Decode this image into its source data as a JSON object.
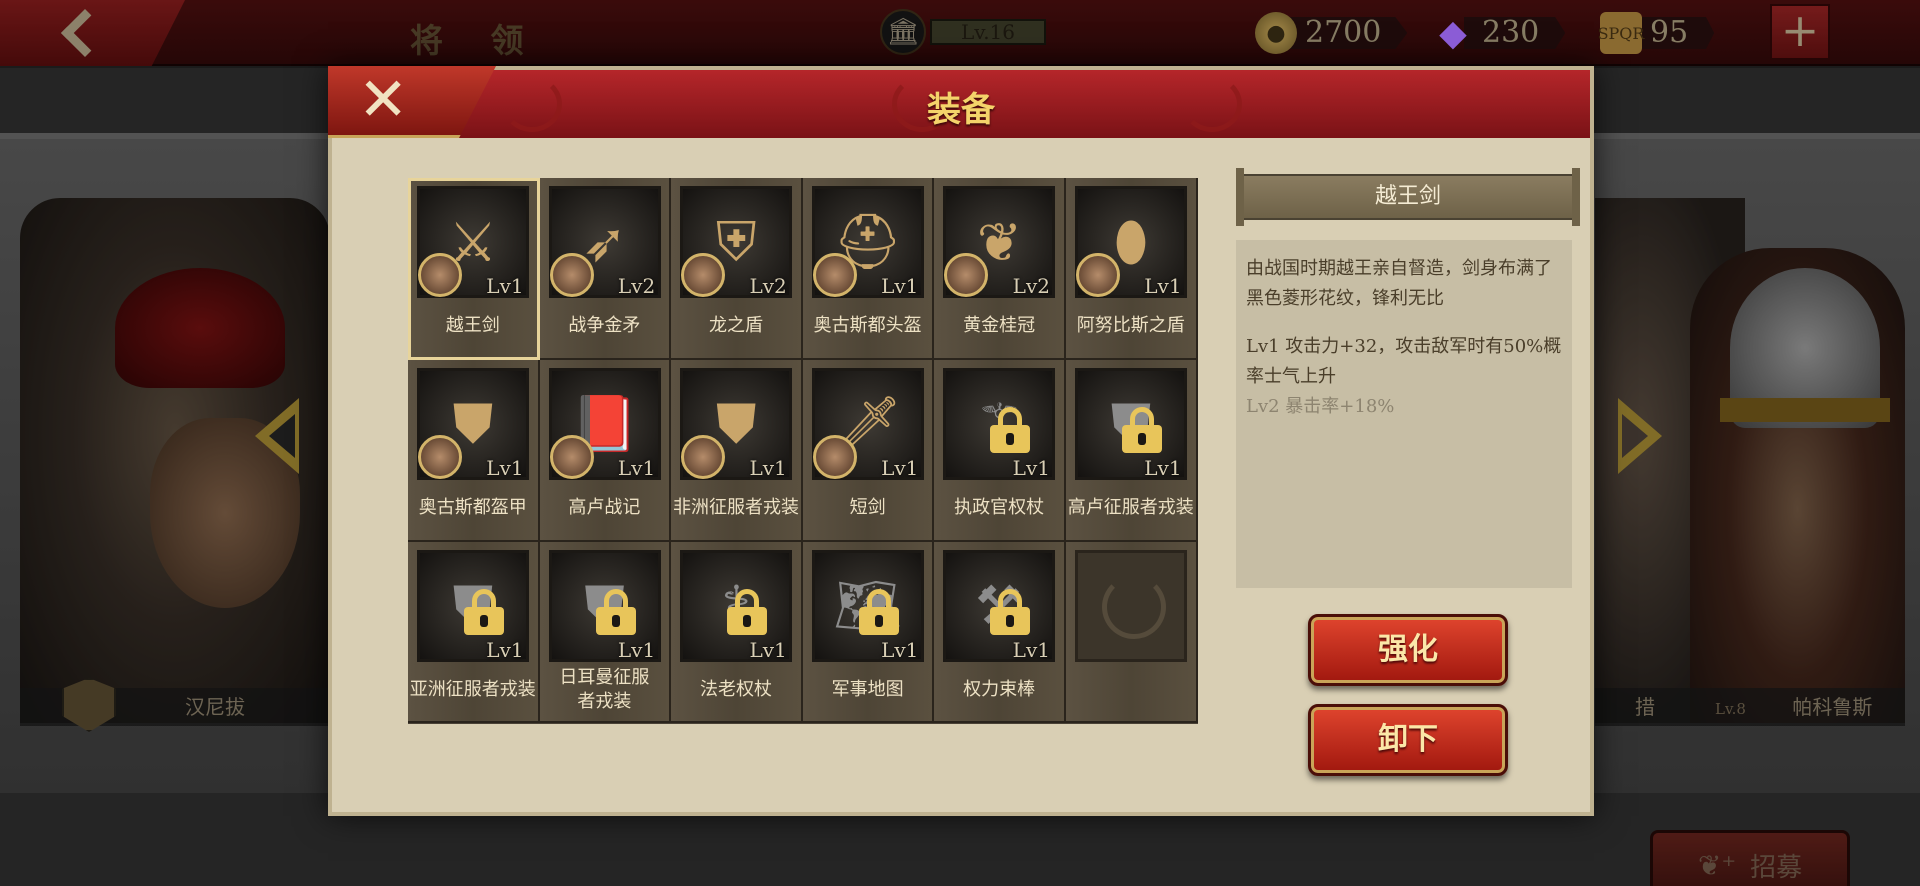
{
  "topbar": {
    "title": "将 领",
    "level": "Lv.16",
    "gold": "2700",
    "gems": "230",
    "honor": "95",
    "add_symbol": "+"
  },
  "background": {
    "hero_left_name": "汉尼拔",
    "hero_right1_name": "措",
    "hero_right2_level": "Lv.8",
    "hero_right2_name": "帕科鲁斯",
    "recruit_label": "招募"
  },
  "modal": {
    "title": "装备",
    "close_symbol": "✕"
  },
  "items": [
    {
      "name": "越王剑",
      "level": "Lv1",
      "owned": true,
      "selected": true,
      "icon": "sword"
    },
    {
      "name": "战争金矛",
      "level": "Lv2",
      "owned": true,
      "icon": "spear"
    },
    {
      "name": "龙之盾",
      "level": "Lv2",
      "owned": true,
      "icon": "shield"
    },
    {
      "name": "奥古斯都头盔",
      "level": "Lv1",
      "owned": true,
      "icon": "helmet"
    },
    {
      "name": "黄金桂冠",
      "level": "Lv2",
      "owned": true,
      "icon": "laurel-crown"
    },
    {
      "name": "阿努比斯之盾",
      "level": "Lv1",
      "owned": true,
      "icon": "oval-shield"
    },
    {
      "name": "奥古斯都盔甲",
      "level": "Lv1",
      "owned": true,
      "icon": "armor"
    },
    {
      "name": "高卢战记",
      "level": "Lv1",
      "owned": true,
      "icon": "book"
    },
    {
      "name": "非洲征服者戎装",
      "level": "Lv1",
      "owned": true,
      "icon": "armor"
    },
    {
      "name": "短剑",
      "level": "Lv1",
      "owned": true,
      "icon": "short-sword"
    },
    {
      "name": "执政官权杖",
      "level": "Lv1",
      "owned": false,
      "icon": "scepter"
    },
    {
      "name": "高卢征服者戎装",
      "level": "Lv1",
      "owned": false,
      "icon": "armor"
    },
    {
      "name": "亚洲征服者戎装",
      "level": "Lv1",
      "owned": false,
      "icon": "armor"
    },
    {
      "name": "日耳曼征服者戎装",
      "level": "Lv1",
      "owned": false,
      "icon": "armor"
    },
    {
      "name": "法老权杖",
      "level": "Lv1",
      "owned": false,
      "icon": "crook-flail"
    },
    {
      "name": "军事地图",
      "level": "Lv1",
      "owned": false,
      "icon": "map"
    },
    {
      "name": "权力束棒",
      "level": "Lv1",
      "owned": false,
      "icon": "fasces"
    },
    {
      "name": "",
      "level": "",
      "owned": false,
      "icon": "empty-slot"
    }
  ],
  "detail": {
    "title": "越王剑",
    "description": "由战国时期越王亲自督造，剑身布满了黑色菱形花纹，锋利无比",
    "stat_lv1": "Lv1  攻击力+32，攻击敌军时有50%概率士气上升",
    "stat_lv2": "Lv2  暴击率+18%"
  },
  "buttons": {
    "enhance": "强化",
    "unequip": "卸下"
  },
  "colors": {
    "accent_red": "#b5262a",
    "gold_text": "#f4d36a",
    "lock_gold": "#e8c55a"
  }
}
